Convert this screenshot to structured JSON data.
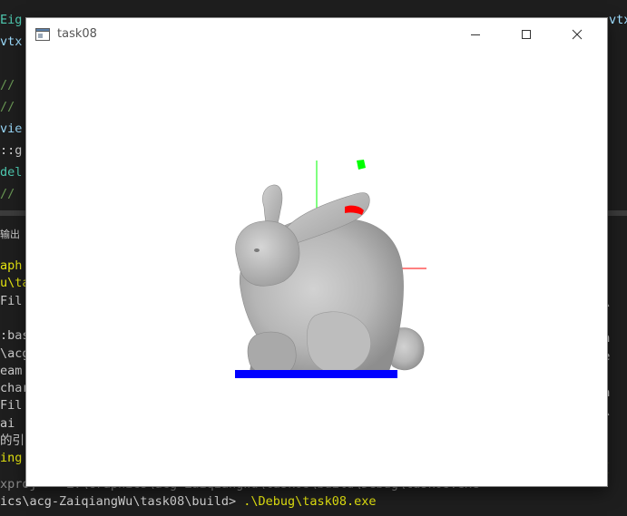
{
  "window": {
    "title": "task08",
    "minimize_glyph": "minimize-icon",
    "maximize_glyph": "maximize-icon",
    "close_glyph": "close-icon"
  },
  "scene": {
    "object": "bunny-mesh",
    "x_axis_color": "#ff0000",
    "y_axis_color": "#00ff00",
    "floor_bar_color": "#0000ff",
    "marker_red_color": "#ff0000",
    "marker_green_color": "#00ff00",
    "mesh_color": "#b8b8b8"
  },
  "background": {
    "editor_lines": [
      {
        "text": "Eig",
        "cls": "c-type"
      },
      {
        "text": "vtx",
        "cls": "c-var"
      },
      {
        "text": "",
        "cls": "c-plain"
      },
      {
        "text": "//",
        "cls": "c-comment"
      },
      {
        "text": "//",
        "cls": "c-comment"
      },
      {
        "text": "vie",
        "cls": "c-var"
      },
      {
        "text": "::g",
        "cls": "c-plain"
      },
      {
        "text": "del",
        "cls": "c-type"
      },
      {
        "text": "// ",
        "cls": "c-comment"
      }
    ],
    "editor_right": [
      {
        "text": "vtx",
        "cls": "c-var"
      },
      {
        "text": "",
        "cls": "c-plain"
      }
    ],
    "panel_tab": "输出",
    "terminal_lines": [
      {
        "text": "aph",
        "cls": "c-yellow"
      },
      {
        "text": "u\\ta",
        "cls": "c-yellow"
      },
      {
        "text": "Fil",
        "cls": "c-default"
      },
      {
        "text": "",
        "cls": "c-default"
      },
      {
        "text": ":bas",
        "cls": "c-default"
      },
      {
        "text": "\\acg",
        "cls": "c-default"
      },
      {
        "text": "eam",
        "cls": "c-default"
      },
      {
        "text": "char",
        "cls": "c-default"
      },
      {
        "text": "Fil",
        "cls": "c-default"
      },
      {
        "text": "ai",
        "cls": "c-default"
      },
      {
        "text": "的引",
        "cls": "c-default"
      },
      {
        "text": "ing",
        "cls": "c-yellow"
      }
    ],
    "terminal_right": [
      {
        "text": "33\\",
        "cls": "c-default"
      },
      {
        "text": "",
        "cls": "c-default"
      },
      {
        "text": "aph",
        "cls": "c-default"
      },
      {
        "text": "age",
        "cls": "c-default"
      },
      {
        "text": "",
        "cls": "c-default"
      },
      {
        "text": "\\ta",
        "cls": "c-default"
      },
      {
        "text": "33\\",
        "cls": "c-default"
      },
      {
        "text": "",
        "cls": "c-default"
      },
      {
        "text": "",
        "cls": "c-default"
      },
      {
        "text": "y [",
        "cls": "c-yellow"
      }
    ],
    "partial_line": "xproj -> Z:\\Graphics\\acg-ZaiqiangWu\\task08\\build\\Debug\\task08.exe",
    "prompt_path": "ics\\acg-ZaiqiangWu\\task08\\build> ",
    "prompt_command": ".\\Debug\\task08.exe"
  }
}
